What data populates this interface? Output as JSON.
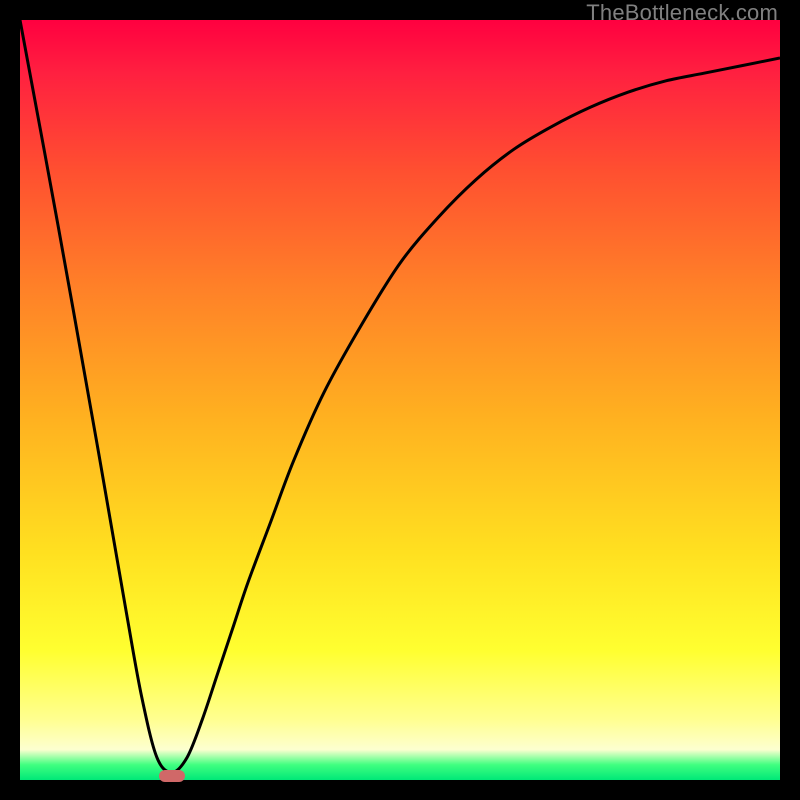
{
  "watermark": "TheBottleneck.com",
  "chart_data": {
    "type": "line",
    "title": "",
    "xlabel": "",
    "ylabel": "",
    "xlim": [
      0,
      100
    ],
    "ylim": [
      0,
      100
    ],
    "x": [
      0,
      5,
      10,
      14,
      16,
      18,
      20,
      22,
      24,
      26,
      28,
      30,
      33,
      36,
      40,
      45,
      50,
      55,
      60,
      65,
      70,
      75,
      80,
      85,
      90,
      95,
      100
    ],
    "y": [
      100,
      73,
      45,
      22,
      11,
      3,
      1,
      3,
      8,
      14,
      20,
      26,
      34,
      42,
      51,
      60,
      68,
      74,
      79,
      83,
      86,
      88.5,
      90.5,
      92,
      93,
      94,
      95
    ],
    "optimum_marker": {
      "x": 20,
      "y": 0.5,
      "color": "#d06868"
    },
    "gradient_stops": [
      {
        "pos": 0.0,
        "color": "#ff0040"
      },
      {
        "pos": 0.07,
        "color": "#ff2040"
      },
      {
        "pos": 0.2,
        "color": "#ff5030"
      },
      {
        "pos": 0.35,
        "color": "#ff8028"
      },
      {
        "pos": 0.52,
        "color": "#ffb020"
      },
      {
        "pos": 0.7,
        "color": "#ffe020"
      },
      {
        "pos": 0.83,
        "color": "#ffff30"
      },
      {
        "pos": 0.92,
        "color": "#ffff90"
      },
      {
        "pos": 0.96,
        "color": "#fdffd0"
      },
      {
        "pos": 0.98,
        "color": "#40ff80"
      },
      {
        "pos": 1.0,
        "color": "#00e878"
      }
    ],
    "curve_color": "#000000",
    "curve_width": 3
  }
}
